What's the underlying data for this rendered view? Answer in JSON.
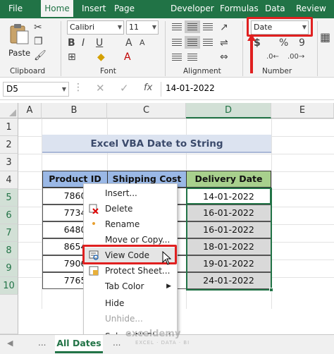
{
  "ribbon": {
    "tabs": [
      "File",
      "Home",
      "Insert",
      "Page Layout",
      "Developer",
      "Formulas",
      "Data",
      "Review"
    ],
    "active_tab": "Home",
    "clipboard": {
      "paste_label": "Paste",
      "group_label": "Clipboard"
    },
    "font": {
      "name": "Calibri",
      "size": "11",
      "bold": "B",
      "italic": "I",
      "underline": "U",
      "grow": "A",
      "shrink": "A",
      "group_label": "Font"
    },
    "alignment": {
      "group_label": "Alignment"
    },
    "number": {
      "format": "Date",
      "currency": "$",
      "percent": "%",
      "comma": "9",
      "group_label": "Number"
    }
  },
  "formula_bar": {
    "name_box": "D5",
    "fx": "fx",
    "value": "14-01-2022"
  },
  "columns": [
    "A",
    "B",
    "C",
    "D",
    "E"
  ],
  "rows": [
    "1",
    "2",
    "3",
    "4",
    "5",
    "6",
    "7",
    "8",
    "9",
    "10"
  ],
  "sheet": {
    "title": "Excel VBA Date to String",
    "headers": [
      "Product ID",
      "Shipping Cost",
      "Delivery Date"
    ],
    "product_ids": [
      "7860",
      "7734",
      "6480",
      "8654",
      "7906",
      "7765"
    ],
    "delivery_dates": [
      "14-01-2022",
      "16-01-2022",
      "16-01-2022",
      "18-01-2022",
      "19-01-2022",
      "24-01-2022"
    ]
  },
  "context_menu": {
    "items": [
      {
        "label": "Insert...",
        "icon": ""
      },
      {
        "label": "Delete",
        "icon": "delete-sheet-icon"
      },
      {
        "label": "Rename",
        "icon": "rename-icon"
      },
      {
        "label": "Move or Copy...",
        "icon": ""
      },
      {
        "label": "View Code",
        "icon": "view-code-icon"
      },
      {
        "label": "Protect Sheet...",
        "icon": "protect-sheet-icon"
      },
      {
        "label": "Tab Color",
        "icon": ""
      },
      {
        "label": "Hide",
        "icon": ""
      },
      {
        "label": "Unhide...",
        "icon": ""
      },
      {
        "label": "Select All Sheets",
        "icon": ""
      }
    ],
    "highlighted": "View Code",
    "disabled": [
      "Unhide..."
    ]
  },
  "sheet_tabs": {
    "active": "All Dates",
    "prev": "◀",
    "more": "..."
  },
  "watermark": {
    "name": "exceldemy",
    "tagline": "EXCEL · DATA · BI"
  },
  "colors": {
    "excel_green": "#217346",
    "highlight_red": "#e02020",
    "header_blue": "#9ab8e6",
    "header_green": "#a8d08d"
  }
}
